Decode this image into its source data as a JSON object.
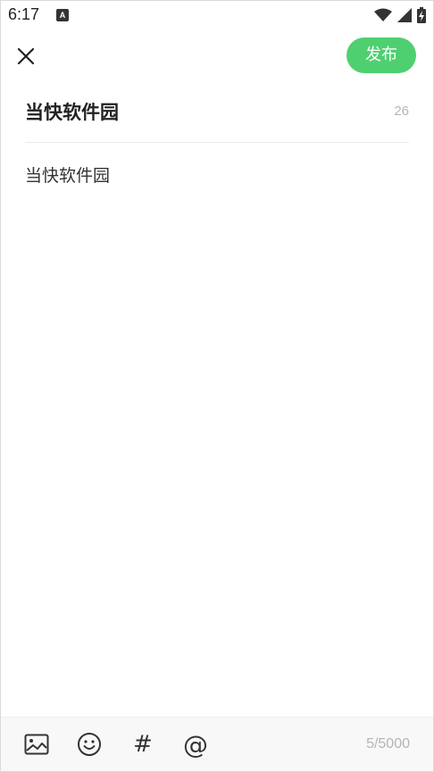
{
  "status_bar": {
    "time": "6:17",
    "notification_icon": "A",
    "icons": [
      "wifi-icon",
      "signal-icon",
      "battery-charging-icon"
    ]
  },
  "top_bar": {
    "close_icon": "close-icon",
    "publish_label": "发布",
    "accent_color": "#4ed070"
  },
  "editor": {
    "title": "当快软件园",
    "title_remaining": "26",
    "body": "当快软件园"
  },
  "bottom_bar": {
    "tools": [
      "image-icon",
      "emoji-icon",
      "hashtag-icon",
      "mention-icon"
    ],
    "hashtag_symbol": "#",
    "mention_symbol": "@",
    "char_count": "5/5000"
  }
}
